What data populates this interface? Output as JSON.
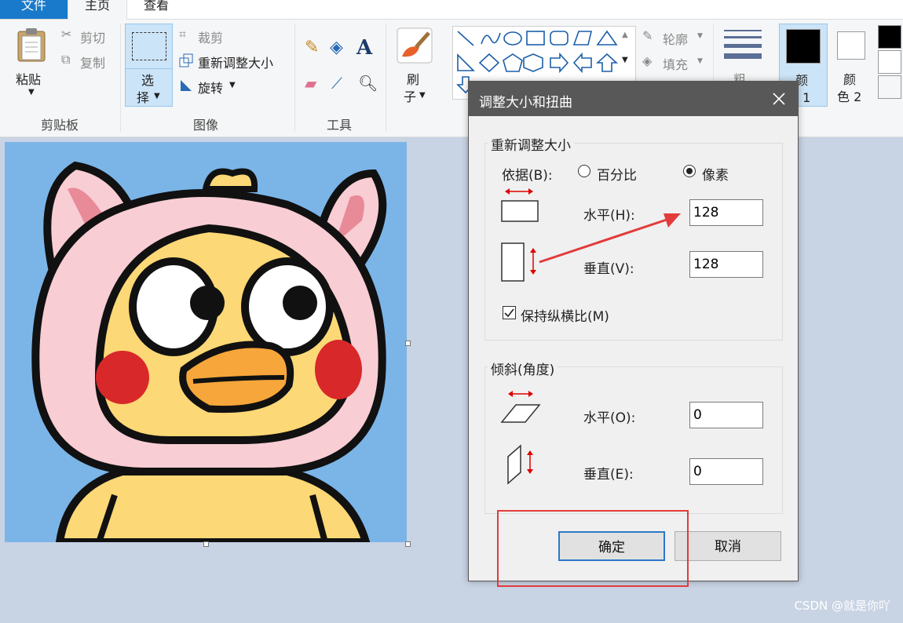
{
  "tabs": {
    "file": "文件",
    "home": "主页",
    "view": "查看"
  },
  "clipboard": {
    "paste": "粘贴",
    "cut": "剪切",
    "copy": "复制",
    "group": "剪贴板"
  },
  "image": {
    "select_1": "选",
    "select_2": "择",
    "crop": "裁剪",
    "resize": "重新调整大小",
    "rotate": "旋转",
    "group": "图像"
  },
  "tools": {
    "group": "工具",
    "text_icon": "A"
  },
  "brush": {
    "label_1": "刷",
    "label_2": "子"
  },
  "shapes": {
    "outline": "轮廓",
    "fill": "填充"
  },
  "size": {
    "label": "粗"
  },
  "colors": {
    "color1_a": "颜",
    "color1_b": "色 1",
    "color2_a": "颜",
    "color2_b": "色 2",
    "color1_value": "#000000",
    "color2_value": "#ffffff"
  },
  "dialog": {
    "title": "调整大小和扭曲",
    "resize_group": "重新调整大小",
    "by_label": "依据(B):",
    "percent": "百分比",
    "pixels": "像素",
    "horizontal_label": "水平(H):",
    "horizontal_value": "128",
    "vertical_label": "垂直(V):",
    "vertical_value": "128",
    "keep_ratio": "保持纵横比(M)",
    "skew_group": "倾斜(角度)",
    "skew_h_label": "水平(O):",
    "skew_h_value": "0",
    "skew_v_label": "垂直(E):",
    "skew_v_value": "0",
    "ok": "确定",
    "cancel": "取消"
  },
  "watermark": "CSDN @就是你吖"
}
